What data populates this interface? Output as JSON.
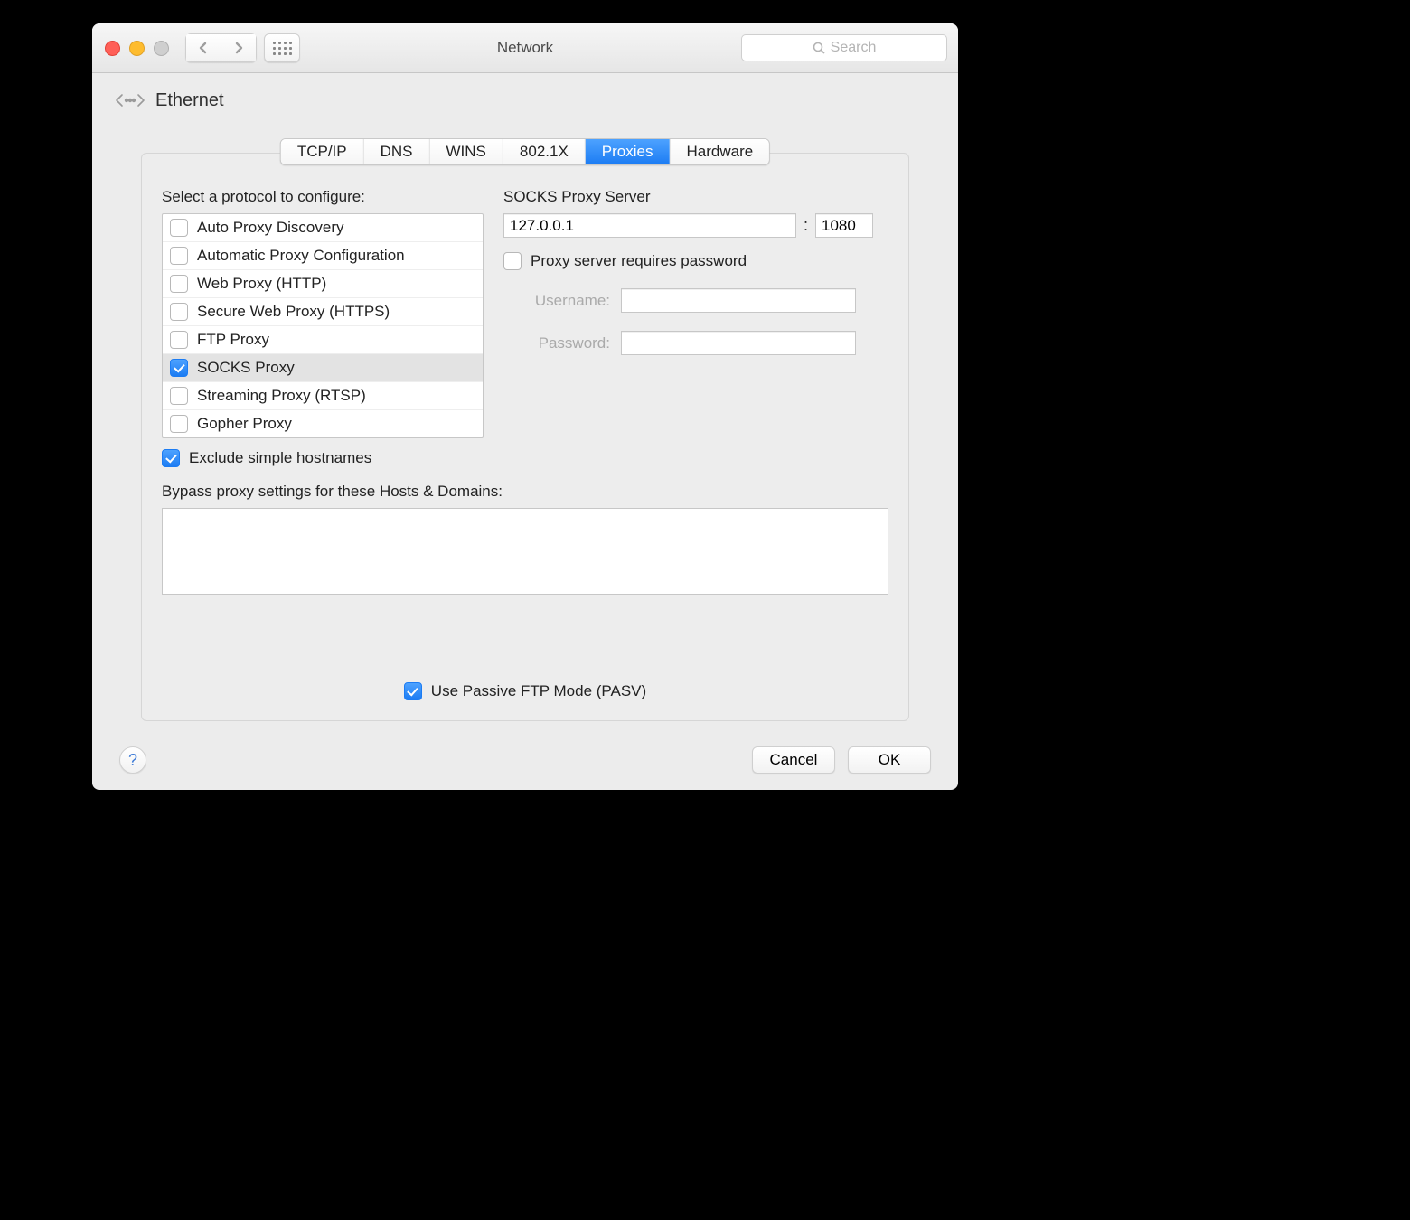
{
  "window": {
    "title": "Network"
  },
  "search": {
    "placeholder": "Search"
  },
  "header": {
    "interface_name": "Ethernet"
  },
  "tabs": {
    "items": [
      "TCP/IP",
      "DNS",
      "WINS",
      "802.1X",
      "Proxies",
      "Hardware"
    ],
    "active_index": 4
  },
  "protocols": {
    "label": "Select a protocol to configure:",
    "items": [
      {
        "label": "Auto Proxy Discovery",
        "checked": false
      },
      {
        "label": "Automatic Proxy Configuration",
        "checked": false
      },
      {
        "label": "Web Proxy (HTTP)",
        "checked": false
      },
      {
        "label": "Secure Web Proxy (HTTPS)",
        "checked": false
      },
      {
        "label": "FTP Proxy",
        "checked": false
      },
      {
        "label": "SOCKS Proxy",
        "checked": true
      },
      {
        "label": "Streaming Proxy (RTSP)",
        "checked": false
      },
      {
        "label": "Gopher Proxy",
        "checked": false
      }
    ],
    "selected_index": 5
  },
  "exclude_simple": {
    "label": "Exclude simple hostnames",
    "checked": true
  },
  "server": {
    "label": "SOCKS Proxy Server",
    "host": "127.0.0.1",
    "port": "1080"
  },
  "auth": {
    "requires_label": "Proxy server requires password",
    "requires_checked": false,
    "username_label": "Username:",
    "username_value": "",
    "password_label": "Password:",
    "password_value": ""
  },
  "bypass": {
    "label": "Bypass proxy settings for these Hosts & Domains:",
    "value": ""
  },
  "pasv": {
    "label": "Use Passive FTP Mode (PASV)",
    "checked": true
  },
  "footer": {
    "help": "?",
    "cancel": "Cancel",
    "ok": "OK"
  }
}
